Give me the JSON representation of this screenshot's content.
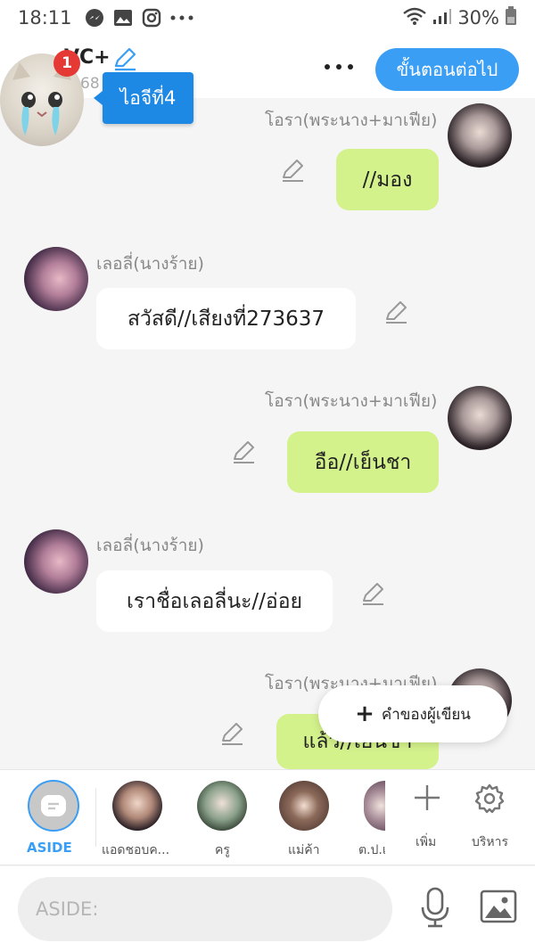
{
  "status_bar": {
    "time": "18:11",
    "battery": "30%"
  },
  "header": {
    "title": "VC+",
    "subtitle": "68",
    "next_button": "ขั้นตอนต่อไป",
    "badge_count": "1",
    "tooltip": "ไอจีที่4"
  },
  "messages": [
    {
      "sender": "โอรา(พระนาง+มาเฟีย)",
      "text": "//มอง",
      "side": "right"
    },
    {
      "sender": "เลอลี่(นางร้าย)",
      "text": "สวัสดี//เสียงที่273637",
      "side": "left"
    },
    {
      "sender": "โอรา(พระนาง+มาเฟีย)",
      "text": "อือ//เย็นชา",
      "side": "right"
    },
    {
      "sender": "เลอลี่(นางร้าย)",
      "text": "เราชื่อเลอลี่นะ//อ่อย",
      "side": "left"
    },
    {
      "sender": "โอรา(พระนาง+มาเฟีย)",
      "text": "แล้ว//เย็นชา",
      "side": "right"
    }
  ],
  "fab": {
    "label": "คำของผู้เขียน"
  },
  "characters": {
    "aside_label": "ASIDE",
    "items": [
      {
        "label": "แอดชอบค..."
      },
      {
        "label": "ครู"
      },
      {
        "label": "แม่ค้า"
      },
      {
        "label": "ต.ป.เ"
      }
    ],
    "add_label": "เพิ่ม",
    "manage_label": "บริหาร"
  },
  "input": {
    "placeholder": "ASIDE:"
  }
}
